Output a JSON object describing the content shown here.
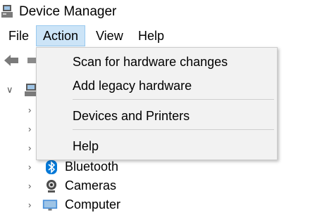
{
  "window": {
    "title": "Device Manager"
  },
  "menubar": {
    "items": [
      "File",
      "Action",
      "View",
      "Help"
    ],
    "active_index": 1
  },
  "action_menu": {
    "items": [
      {
        "label": "Scan for hardware changes"
      },
      {
        "label": "Add legacy hardware"
      },
      {
        "label": "Devices and Printers"
      },
      {
        "label": "Help"
      }
    ]
  },
  "tree": {
    "visible_nodes": [
      {
        "label": "Bluetooth",
        "icon": "bluetooth-icon"
      },
      {
        "label": "Cameras",
        "icon": "camera-icon"
      },
      {
        "label": "Computer",
        "icon": "computer-icon"
      }
    ]
  },
  "colors": {
    "menu_active_bg": "#cce4f7",
    "menu_bg": "#f2f2f2",
    "bluetooth_blue": "#0078d7"
  }
}
